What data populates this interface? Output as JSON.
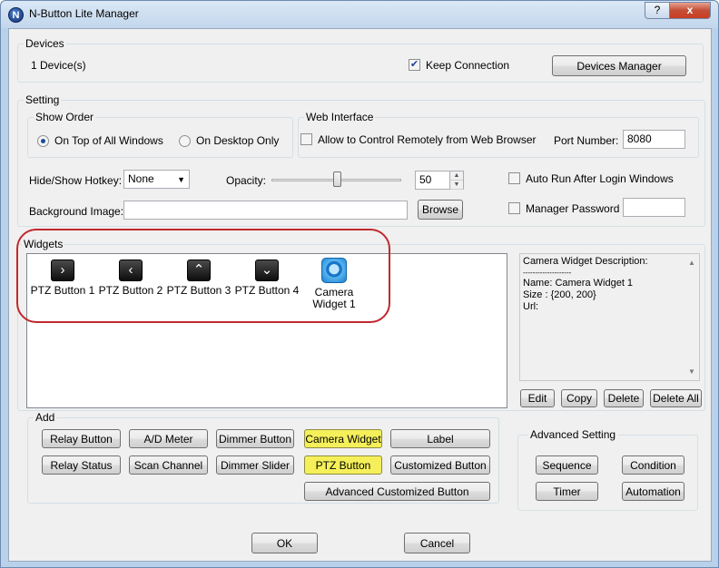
{
  "window": {
    "title": "N-Button Lite Manager",
    "help_label": "?",
    "close_label": "x"
  },
  "devices": {
    "group_label": "Devices",
    "count_text": "1 Device(s)",
    "keep_connection_label": "Keep Connection",
    "keep_connection_checked": true,
    "manager_button": "Devices Manager"
  },
  "setting": {
    "group_label": "Setting",
    "show_order": {
      "group_label": "Show Order",
      "option_top": "On Top of All Windows",
      "option_desktop": "On Desktop Only",
      "selected": "On Top of All Windows"
    },
    "web_interface": {
      "group_label": "Web Interface",
      "allow_label": "Allow to Control Remotely from Web Browser",
      "allow_checked": false,
      "port_label": "Port Number:",
      "port_value": "8080"
    },
    "hotkey_label": "Hide/Show Hotkey:",
    "hotkey_value": "None",
    "opacity_label": "Opacity:",
    "opacity_value": "50",
    "opacity_level_percent": 50,
    "auto_run_label": "Auto Run After Login Windows",
    "auto_run_checked": false,
    "background_label": "Background Image:",
    "background_value": "",
    "browse_button": "Browse",
    "password_label": "Manager Password",
    "password_checked": false,
    "password_value": ""
  },
  "widgets": {
    "group_label": "Widgets",
    "items": [
      {
        "label": "PTZ Button 1",
        "icon": "chevron-right-icon",
        "glyph": "›"
      },
      {
        "label": "PTZ Button 2",
        "icon": "chevron-left-icon",
        "glyph": "‹"
      },
      {
        "label": "PTZ Button 3",
        "icon": "chevron-up-icon",
        "glyph": "⌃"
      },
      {
        "label": "PTZ Button 4",
        "icon": "chevron-down-icon",
        "glyph": "⌄"
      },
      {
        "label": "Camera\nWidget 1",
        "icon": "camera-icon",
        "glyph": ""
      }
    ],
    "description": {
      "heading": "Camera Widget Description:",
      "separator": "--------------------",
      "name": "Name: Camera Widget 1",
      "size": "Size : {200, 200}",
      "url": "Url:"
    },
    "buttons": {
      "edit": "Edit",
      "copy": "Copy",
      "delete": "Delete",
      "delete_all": "Delete All"
    }
  },
  "add": {
    "group_label": "Add",
    "relay_button": "Relay Button",
    "ad_meter": "A/D Meter",
    "dimmer_button": "Dimmer Button",
    "camera_widget": "Camera Widget",
    "label": "Label",
    "relay_status": "Relay Status",
    "scan_channel": "Scan Channel",
    "dimmer_slider": "Dimmer Slider",
    "ptz_button": "PTZ Button",
    "customized_button": "Customized Button",
    "advanced_customized_button": "Advanced Customized Button",
    "highlight_color": "#f5f05a"
  },
  "advanced": {
    "group_label": "Advanced Setting",
    "sequence": "Sequence",
    "condition": "Condition",
    "timer": "Timer",
    "automation": "Automation"
  },
  "footer": {
    "ok": "OK",
    "cancel": "Cancel"
  },
  "colors": {
    "annotation_outline": "#c0292e",
    "title_bar": "#c2d6ec"
  }
}
